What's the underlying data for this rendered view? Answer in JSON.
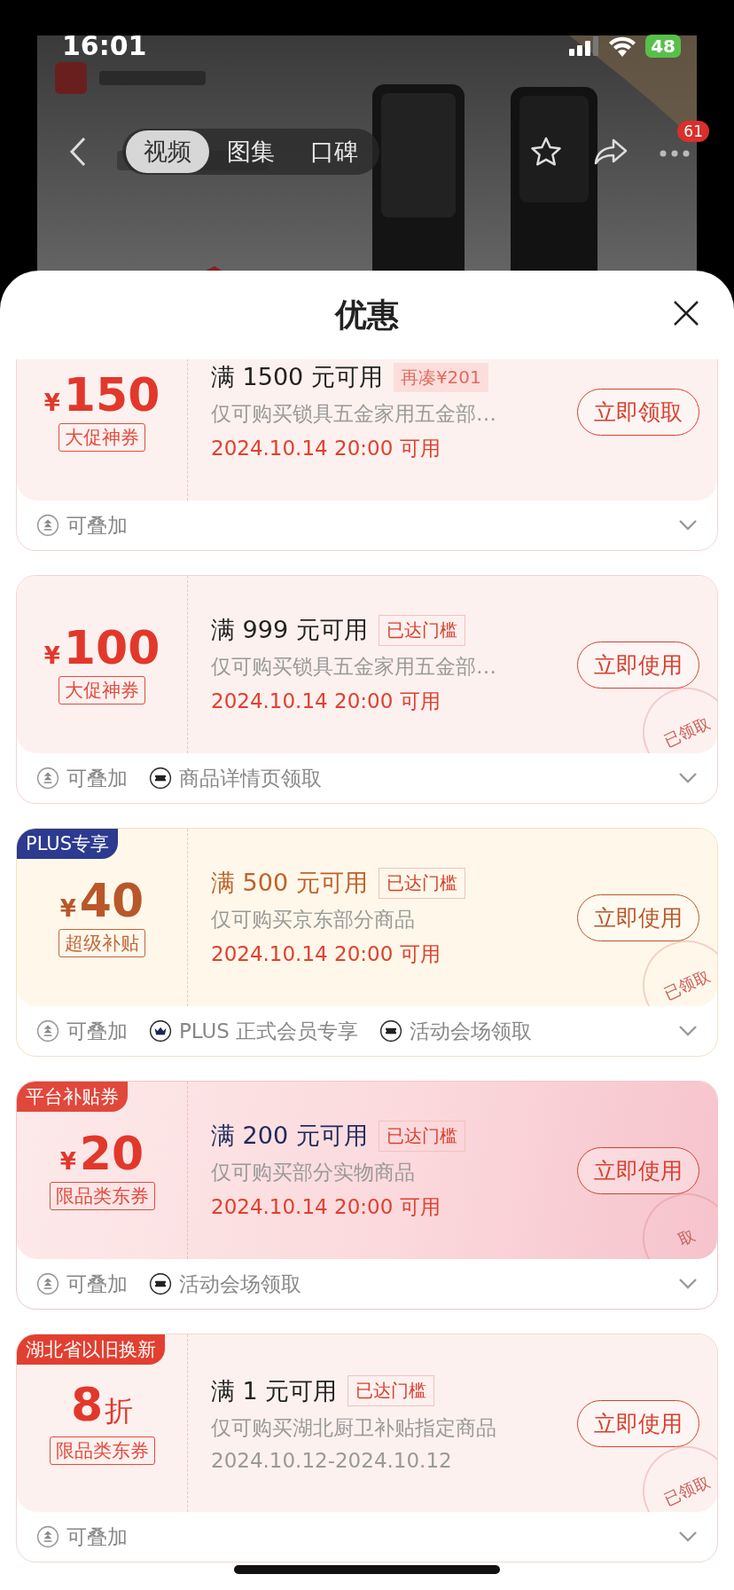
{
  "status_bar": {
    "time": "16:01",
    "battery": "48"
  },
  "media_tabs": [
    {
      "label": "视频",
      "selected": true
    },
    {
      "label": "图集",
      "selected": false
    },
    {
      "label": "口碑",
      "selected": false
    }
  ],
  "more_badge": "61",
  "sheet": {
    "title": "优惠"
  },
  "coupons": [
    {
      "kind": "standard",
      "prefix": "¥",
      "amount": "150",
      "label": "大促神券",
      "condition": "满 1500 元可用",
      "tag": {
        "kind": "filled",
        "text": "再凑¥201"
      },
      "description": "仅可购买锁具五金家用五金部…",
      "date": "2024.10.14 20:00 可用",
      "date_highlight": true,
      "button": "立即领取",
      "claimed": false,
      "footer": [
        {
          "kind": "stack",
          "text": "可叠加"
        }
      ]
    },
    {
      "kind": "standard",
      "prefix": "¥",
      "amount": "100",
      "label": "大促神券",
      "condition": "满 999 元可用",
      "tag": {
        "kind": "outline",
        "text": "已达门槛"
      },
      "description": "仅可购买锁具五金家用五金部…",
      "date": "2024.10.14 20:00 可用",
      "date_highlight": true,
      "button": "立即使用",
      "claimed": true,
      "stamp": "已领取",
      "footer": [
        {
          "kind": "stack",
          "text": "可叠加"
        },
        {
          "kind": "ticket",
          "text": "商品详情页领取"
        }
      ]
    },
    {
      "kind": "plus",
      "corner_tag": {
        "text": "PLUS专享",
        "color": "#2c3a8f"
      },
      "prefix": "¥",
      "amount": "40",
      "label": "超级补贴",
      "condition": "满 500 元可用",
      "tag": {
        "kind": "outline",
        "text": "已达门槛"
      },
      "description": "仅可购买京东部分商品",
      "date": "2024.10.14 20:00 可用",
      "date_highlight": true,
      "button": "立即使用",
      "claimed": true,
      "stamp": "已领取",
      "footer": [
        {
          "kind": "stack",
          "text": "可叠加"
        },
        {
          "kind": "crown",
          "text": "PLUS 正式会员专享"
        },
        {
          "kind": "ticket",
          "text": "活动会场领取"
        }
      ]
    },
    {
      "kind": "platform",
      "corner_tag": {
        "text": "平台补贴券",
        "color": "#e0483c"
      },
      "prefix": "¥",
      "amount": "20",
      "label": "限品类东券",
      "condition": "满 200 元可用",
      "tag": {
        "kind": "outline",
        "text": "已达门槛"
      },
      "description": "仅可购买部分实物商品",
      "date": "2024.10.14 20:00 可用",
      "date_highlight": true,
      "button": "立即使用",
      "claimed": true,
      "stamp": "取",
      "footer": [
        {
          "kind": "stack",
          "text": "可叠加"
        },
        {
          "kind": "ticket",
          "text": "活动会场领取"
        }
      ]
    },
    {
      "kind": "standard",
      "corner_tag": {
        "text": "湖北省以旧换新",
        "color": "#e23f30"
      },
      "amount": "8",
      "suffix": "折",
      "label": "限品类东券",
      "condition": "满 1 元可用",
      "tag": {
        "kind": "outline",
        "text": "已达门槛"
      },
      "description": "仅可购买湖北厨卫补贴指定商品",
      "date": "2024.10.12-2024.10.12",
      "date_highlight": false,
      "button": "立即使用",
      "claimed": true,
      "stamp": "已领取",
      "footer": [
        {
          "kind": "stack",
          "text": "可叠加"
        }
      ]
    }
  ]
}
